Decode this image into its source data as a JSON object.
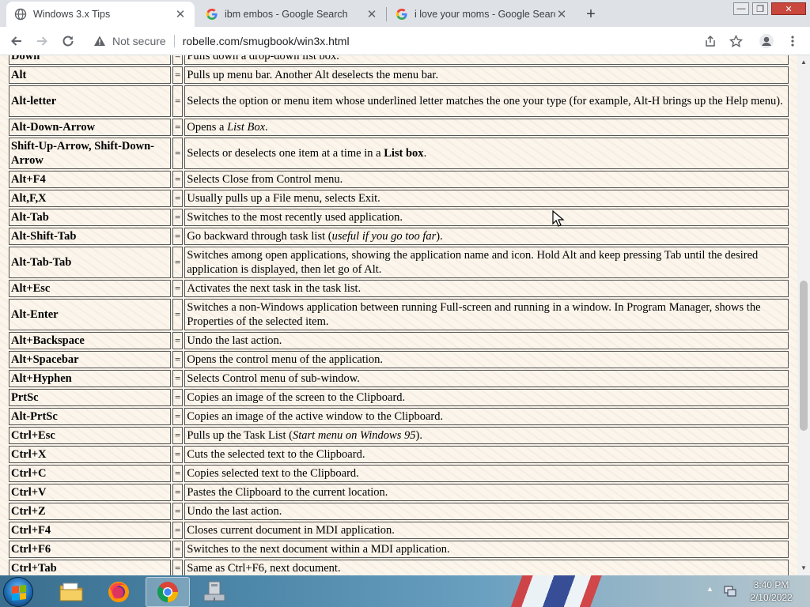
{
  "browser": {
    "tabs": [
      {
        "title": "Windows 3.x Tips",
        "active": true
      },
      {
        "title": "ibm embos - Google Search",
        "active": false
      },
      {
        "title": "i love your moms - Google Search",
        "active": false
      }
    ],
    "security_label": "Not secure",
    "url": "robelle.com/smugbook/win3x.html"
  },
  "shortcuts": [
    {
      "key": "Down",
      "desc": [
        {
          "t": "Pulls down a drop-down list box."
        }
      ]
    },
    {
      "key": "Alt",
      "desc": [
        {
          "t": "Pulls up menu bar. Another Alt deselects the menu bar."
        }
      ]
    },
    {
      "key": "Alt-letter",
      "desc": [
        {
          "t": "Selects the option or menu item whose underlined letter matches the one your type (for example, Alt-H brings up the Help menu)."
        }
      ]
    },
    {
      "key": "Alt-Down-Arrow",
      "desc": [
        {
          "t": "Opens a "
        },
        {
          "t": "List Box",
          "i": true
        },
        {
          "t": "."
        }
      ]
    },
    {
      "key": "Shift-Up-Arrow, Shift-Down-Arrow",
      "desc": [
        {
          "t": "Selects or deselects one item at a time in a "
        },
        {
          "t": "List box",
          "b": true
        },
        {
          "t": "."
        }
      ]
    },
    {
      "key": "Alt+F4",
      "desc": [
        {
          "t": "Selects Close from Control menu."
        }
      ]
    },
    {
      "key": "Alt,F,X",
      "desc": [
        {
          "t": "Usually pulls up a File menu, selects Exit."
        }
      ]
    },
    {
      "key": "Alt-Tab",
      "desc": [
        {
          "t": "Switches to the most recently used application."
        }
      ]
    },
    {
      "key": "Alt-Shift-Tab",
      "desc": [
        {
          "t": "Go backward through task list ("
        },
        {
          "t": "useful if you go too far",
          "i": true
        },
        {
          "t": ")."
        }
      ]
    },
    {
      "key": "Alt-Tab-Tab",
      "desc": [
        {
          "t": "Switches among open applications, showing the application name and icon. Hold Alt and keep pressing Tab until the desired application is displayed, then let go of Alt."
        }
      ]
    },
    {
      "key": "Alt+Esc",
      "desc": [
        {
          "t": "Activates the next task in the task list."
        }
      ]
    },
    {
      "key": "Alt-Enter",
      "desc": [
        {
          "t": "Switches a non-Windows application between running Full-screen and running in a window. In Program Manager, shows the Properties of the selected item."
        }
      ]
    },
    {
      "key": "Alt+Backspace",
      "desc": [
        {
          "t": "Undo the last action."
        }
      ]
    },
    {
      "key": "Alt+Spacebar",
      "desc": [
        {
          "t": "Opens the control menu of the application."
        }
      ]
    },
    {
      "key": "Alt+Hyphen",
      "desc": [
        {
          "t": "Selects Control menu of sub-window."
        }
      ]
    },
    {
      "key": "PrtSc",
      "desc": [
        {
          "t": "Copies an image of the screen to the Clipboard."
        }
      ]
    },
    {
      "key": "Alt-PrtSc",
      "desc": [
        {
          "t": "Copies an image of the active window to the Clipboard."
        }
      ]
    },
    {
      "key": "Ctrl+Esc",
      "desc": [
        {
          "t": "Pulls up the Task List ("
        },
        {
          "t": "Start menu on Windows 95",
          "i": true
        },
        {
          "t": ")."
        }
      ]
    },
    {
      "key": "Ctrl+X",
      "desc": [
        {
          "t": "Cuts the selected text to the Clipboard."
        }
      ]
    },
    {
      "key": "Ctrl+C",
      "desc": [
        {
          "t": "Copies selected text to the Clipboard."
        }
      ]
    },
    {
      "key": "Ctrl+V",
      "desc": [
        {
          "t": "Pastes the Clipboard to the current location."
        }
      ]
    },
    {
      "key": "Ctrl+Z",
      "desc": [
        {
          "t": "Undo the last action."
        }
      ]
    },
    {
      "key": "Ctrl+F4",
      "desc": [
        {
          "t": "Closes current document in MDI application."
        }
      ]
    },
    {
      "key": "Ctrl+F6",
      "desc": [
        {
          "t": "Switches to the next document within a MDI application."
        }
      ]
    },
    {
      "key": "Ctrl+Tab",
      "desc": [
        {
          "t": "Same as Ctrl+F6, next document."
        }
      ]
    }
  ],
  "separator": "=",
  "taskbar": {
    "items": [
      "windows-explorer",
      "firefox",
      "chrome",
      "network-computer"
    ],
    "clock_time": "3:40 PM",
    "clock_date": "2/10/2022"
  }
}
